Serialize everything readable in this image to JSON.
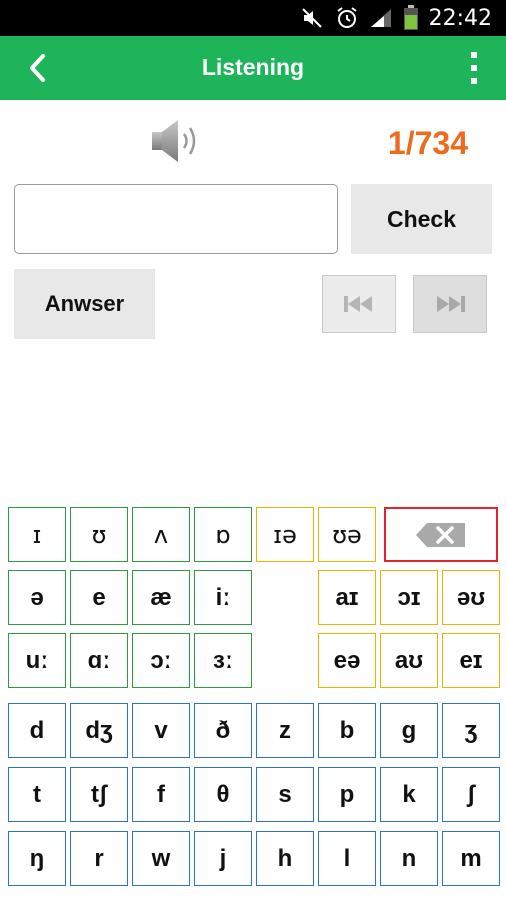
{
  "status_bar": {
    "time": "22:42",
    "icons": [
      "mute-icon",
      "alarm-icon",
      "signal-icon",
      "battery-icon"
    ],
    "battery_color": "#7ec63a"
  },
  "app_bar": {
    "title": "Listening",
    "background": "#1db45a",
    "back_icon": "chevron-left-icon",
    "menu_icon": "overflow-menu-icon"
  },
  "player": {
    "speaker_icon": "speaker-icon",
    "counter": "1/734",
    "counter_color": "#f06a1e"
  },
  "input": {
    "value": "",
    "placeholder": ""
  },
  "buttons": {
    "check": "Check",
    "answer": "Anwser",
    "prev_icon": "skip-previous-icon",
    "next_icon": "skip-next-icon"
  },
  "keyboard": {
    "colors": {
      "green": "#2a9a45",
      "yellow": "#f0b400",
      "blue": "#2b72c9",
      "delete": "#e0232e"
    },
    "row1": [
      "ɪ",
      "ʊ",
      "ʌ",
      "ɒ",
      "ɪə",
      "ʊə"
    ],
    "row2_left": [
      "ə",
      "e",
      "æ",
      "iː"
    ],
    "row2_right": [
      "aɪ",
      "ɔɪ",
      "əʊ"
    ],
    "row3_left": [
      "uː",
      "ɑː",
      "ɔː",
      "ɜː"
    ],
    "row3_right": [
      "eə",
      "aʊ",
      "eɪ"
    ],
    "row4": [
      "d",
      "dʒ",
      "v",
      "ð",
      "z",
      "b",
      "g",
      "ʒ"
    ],
    "row5": [
      "t",
      "tʃ",
      "f",
      "θ",
      "s",
      "p",
      "k",
      "ʃ"
    ],
    "row6": [
      "ŋ",
      "r",
      "w",
      "j",
      "h",
      "l",
      "n",
      "m"
    ],
    "delete_icon": "backspace-icon"
  }
}
